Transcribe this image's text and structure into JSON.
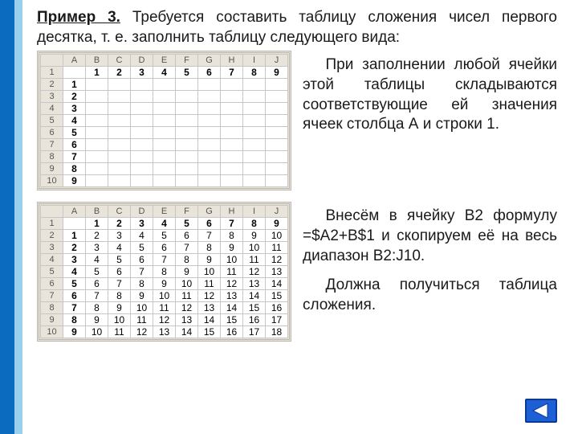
{
  "heading": {
    "title": "Пример 3.",
    "rest": " Требуется составить таблицу сложения чисел первого десятка, т. е. заполнить таблицу следующего вида:"
  },
  "paragraphs": {
    "p1": "При заполнении любой ячейки этой таблицы складываются соответствующие ей значения ячеек столбца А и строки 1.",
    "p2": "Внесём в ячейку В2 формулу =$A2+B$1 и скопируем её на весь диапазон B2:J10.",
    "p3": "Должна получиться таблица сложения."
  },
  "sheet_empty": {
    "columns": [
      "A",
      "B",
      "C",
      "D",
      "E",
      "F",
      "G",
      "H",
      "I",
      "J"
    ],
    "rows": [
      {
        "n": "1",
        "cells": [
          "",
          "1",
          "2",
          "3",
          "4",
          "5",
          "6",
          "7",
          "8",
          "9"
        ]
      },
      {
        "n": "2",
        "cells": [
          "1",
          "",
          "",
          "",
          "",
          "",
          "",
          "",
          "",
          ""
        ]
      },
      {
        "n": "3",
        "cells": [
          "2",
          "",
          "",
          "",
          "",
          "",
          "",
          "",
          "",
          ""
        ]
      },
      {
        "n": "4",
        "cells": [
          "3",
          "",
          "",
          "",
          "",
          "",
          "",
          "",
          "",
          ""
        ]
      },
      {
        "n": "5",
        "cells": [
          "4",
          "",
          "",
          "",
          "",
          "",
          "",
          "",
          "",
          ""
        ]
      },
      {
        "n": "6",
        "cells": [
          "5",
          "",
          "",
          "",
          "",
          "",
          "",
          "",
          "",
          ""
        ]
      },
      {
        "n": "7",
        "cells": [
          "6",
          "",
          "",
          "",
          "",
          "",
          "",
          "",
          "",
          ""
        ]
      },
      {
        "n": "8",
        "cells": [
          "7",
          "",
          "",
          "",
          "",
          "",
          "",
          "",
          "",
          ""
        ]
      },
      {
        "n": "9",
        "cells": [
          "8",
          "",
          "",
          "",
          "",
          "",
          "",
          "",
          "",
          ""
        ]
      },
      {
        "n": "10",
        "cells": [
          "9",
          "",
          "",
          "",
          "",
          "",
          "",
          "",
          "",
          ""
        ]
      }
    ]
  },
  "sheet_filled": {
    "columns": [
      "A",
      "B",
      "C",
      "D",
      "E",
      "F",
      "G",
      "H",
      "I",
      "J"
    ],
    "rows": [
      {
        "n": "1",
        "cells": [
          "",
          "1",
          "2",
          "3",
          "4",
          "5",
          "6",
          "7",
          "8",
          "9"
        ]
      },
      {
        "n": "2",
        "cells": [
          "1",
          "2",
          "3",
          "4",
          "5",
          "6",
          "7",
          "8",
          "9",
          "10"
        ]
      },
      {
        "n": "3",
        "cells": [
          "2",
          "3",
          "4",
          "5",
          "6",
          "7",
          "8",
          "9",
          "10",
          "11"
        ]
      },
      {
        "n": "4",
        "cells": [
          "3",
          "4",
          "5",
          "6",
          "7",
          "8",
          "9",
          "10",
          "11",
          "12"
        ]
      },
      {
        "n": "5",
        "cells": [
          "4",
          "5",
          "6",
          "7",
          "8",
          "9",
          "10",
          "11",
          "12",
          "13"
        ]
      },
      {
        "n": "6",
        "cells": [
          "5",
          "6",
          "7",
          "8",
          "9",
          "10",
          "11",
          "12",
          "13",
          "14"
        ]
      },
      {
        "n": "7",
        "cells": [
          "6",
          "7",
          "8",
          "9",
          "10",
          "11",
          "12",
          "13",
          "14",
          "15"
        ]
      },
      {
        "n": "8",
        "cells": [
          "7",
          "8",
          "9",
          "10",
          "11",
          "12",
          "13",
          "14",
          "15",
          "16"
        ]
      },
      {
        "n": "9",
        "cells": [
          "8",
          "9",
          "10",
          "11",
          "12",
          "13",
          "14",
          "15",
          "16",
          "17"
        ]
      },
      {
        "n": "10",
        "cells": [
          "9",
          "10",
          "11",
          "12",
          "13",
          "14",
          "15",
          "16",
          "17",
          "18"
        ]
      }
    ]
  },
  "chart_data": {
    "type": "table",
    "title": "Addition table of first ten numbers",
    "columns": [
      "A",
      "B",
      "C",
      "D",
      "E",
      "F",
      "G",
      "H",
      "I",
      "J"
    ],
    "row_headers": [
      1,
      2,
      3,
      4,
      5,
      6,
      7,
      8,
      9
    ],
    "col_headers": [
      1,
      2,
      3,
      4,
      5,
      6,
      7,
      8,
      9
    ],
    "values": [
      [
        2,
        3,
        4,
        5,
        6,
        7,
        8,
        9,
        10
      ],
      [
        3,
        4,
        5,
        6,
        7,
        8,
        9,
        10,
        11
      ],
      [
        4,
        5,
        6,
        7,
        8,
        9,
        10,
        11,
        12
      ],
      [
        5,
        6,
        7,
        8,
        9,
        10,
        11,
        12,
        13
      ],
      [
        6,
        7,
        8,
        9,
        10,
        11,
        12,
        13,
        14
      ],
      [
        7,
        8,
        9,
        10,
        11,
        12,
        13,
        14,
        15
      ],
      [
        8,
        9,
        10,
        11,
        12,
        13,
        14,
        15,
        16
      ],
      [
        9,
        10,
        11,
        12,
        13,
        14,
        15,
        16,
        17
      ],
      [
        10,
        11,
        12,
        13,
        14,
        15,
        16,
        17,
        18
      ]
    ]
  }
}
